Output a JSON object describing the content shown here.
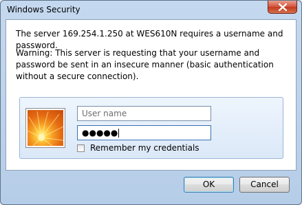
{
  "window": {
    "title": "Windows Security"
  },
  "message": "The server 169.254.1.250 at WES610N requires a username and password.",
  "warning": "Warning: This server is requesting that your username and password be sent in an insecure manner (basic authentication without a secure connection).",
  "credentials": {
    "username_placeholder": "User name",
    "password_value": "●●●●●",
    "remember_label": "Remember my credentials",
    "remember_checked": false
  },
  "buttons": {
    "ok_label": "OK",
    "cancel_label": "Cancel"
  },
  "icons": {
    "close": "close-icon",
    "avatar": "user-avatar-flower"
  }
}
